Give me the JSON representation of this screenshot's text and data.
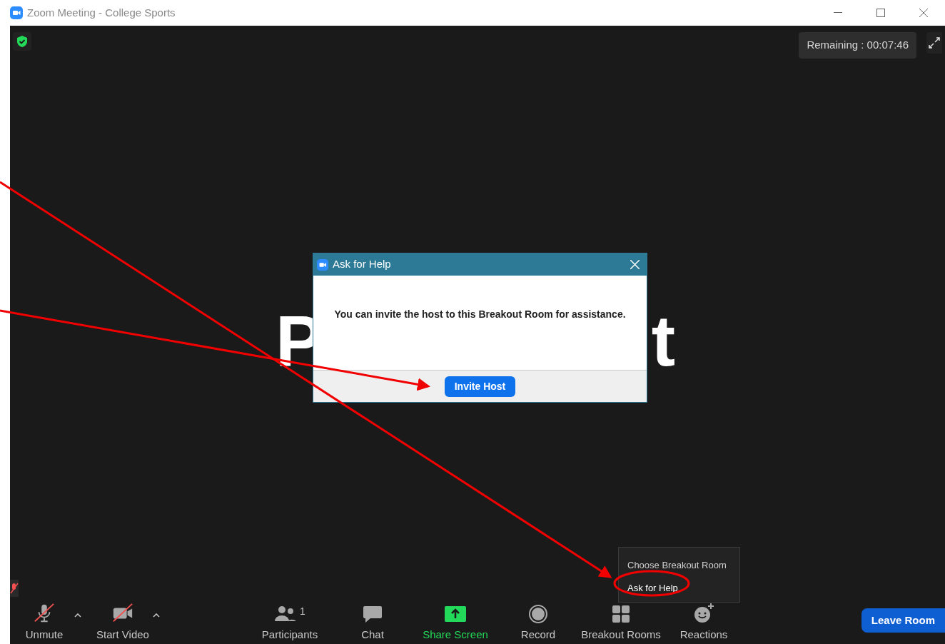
{
  "window": {
    "title": "Zoom Meeting - College Sports"
  },
  "meeting": {
    "remaining": "Remaining : 00:07:46",
    "name_fragments": [
      "P",
      "t"
    ],
    "self_muted": true
  },
  "dialog": {
    "title": "Ask for Help",
    "message": "You can invite the host to this Breakout Room for assistance.",
    "button": "Invite Host"
  },
  "breakout_menu": {
    "items": [
      {
        "label": "Choose Breakout Room",
        "highlighted": false
      },
      {
        "label": "Ask for Help",
        "highlighted": true
      }
    ]
  },
  "toolbar": {
    "left": [
      {
        "kind": "mic",
        "label": "Unmute",
        "off": true
      },
      {
        "kind": "video",
        "label": "Start Video",
        "off": true
      }
    ],
    "center": [
      {
        "kind": "participants",
        "label": "Participants",
        "count": "1"
      },
      {
        "kind": "chat",
        "label": "Chat"
      },
      {
        "kind": "share",
        "label": "Share Screen"
      },
      {
        "kind": "record",
        "label": "Record"
      },
      {
        "kind": "breakout",
        "label": "Breakout Rooms"
      },
      {
        "kind": "reactions",
        "label": "Reactions"
      }
    ],
    "leave": "Leave Room"
  }
}
